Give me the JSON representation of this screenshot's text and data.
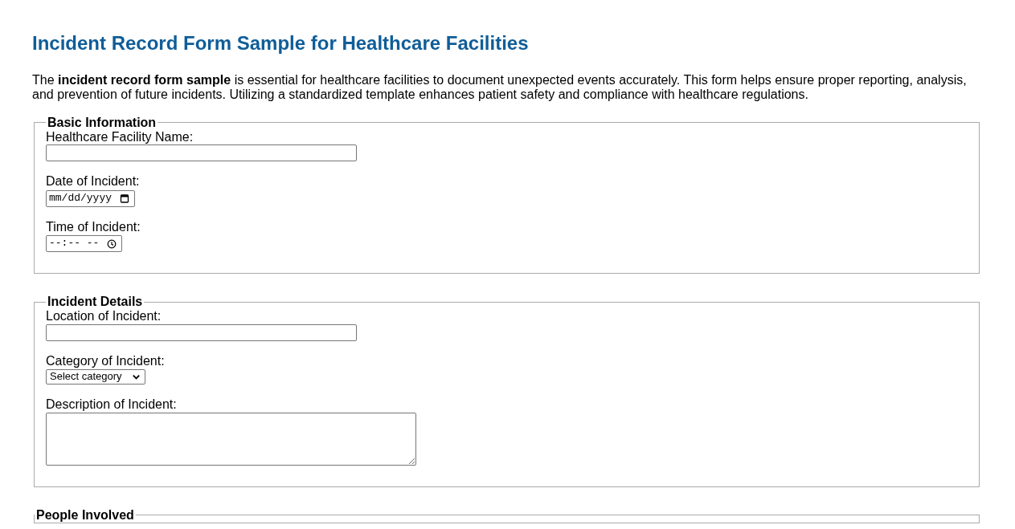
{
  "title": "Incident Record Form Sample for Healthcare Facilities",
  "intro": "The **incident record form sample** is essential for healthcare facilities to document unexpected events accurately. This form helps ensure proper reporting, analysis, and prevention of future incidents. Utilizing a standardized template enhances patient safety and compliance with healthcare regulations.",
  "sections": [
    {
      "legend": "Basic Information",
      "fields": [
        {
          "kind": "text",
          "label": "Healthcare Facility Name:"
        },
        {
          "kind": "date",
          "label": "Date of Incident:",
          "placeholder": "mm/dd/yyyy"
        },
        {
          "kind": "time",
          "label": "Time of Incident:",
          "placeholder": "--:-- --"
        }
      ]
    },
    {
      "legend": "Incident Details",
      "fields": [
        {
          "kind": "text",
          "label": "Location of Incident:"
        },
        {
          "kind": "select",
          "label": "Category of Incident:",
          "value": "Select category"
        },
        {
          "kind": "textarea",
          "label": "Description of Incident:"
        }
      ]
    },
    {
      "legend": "People Involved"
    }
  ]
}
